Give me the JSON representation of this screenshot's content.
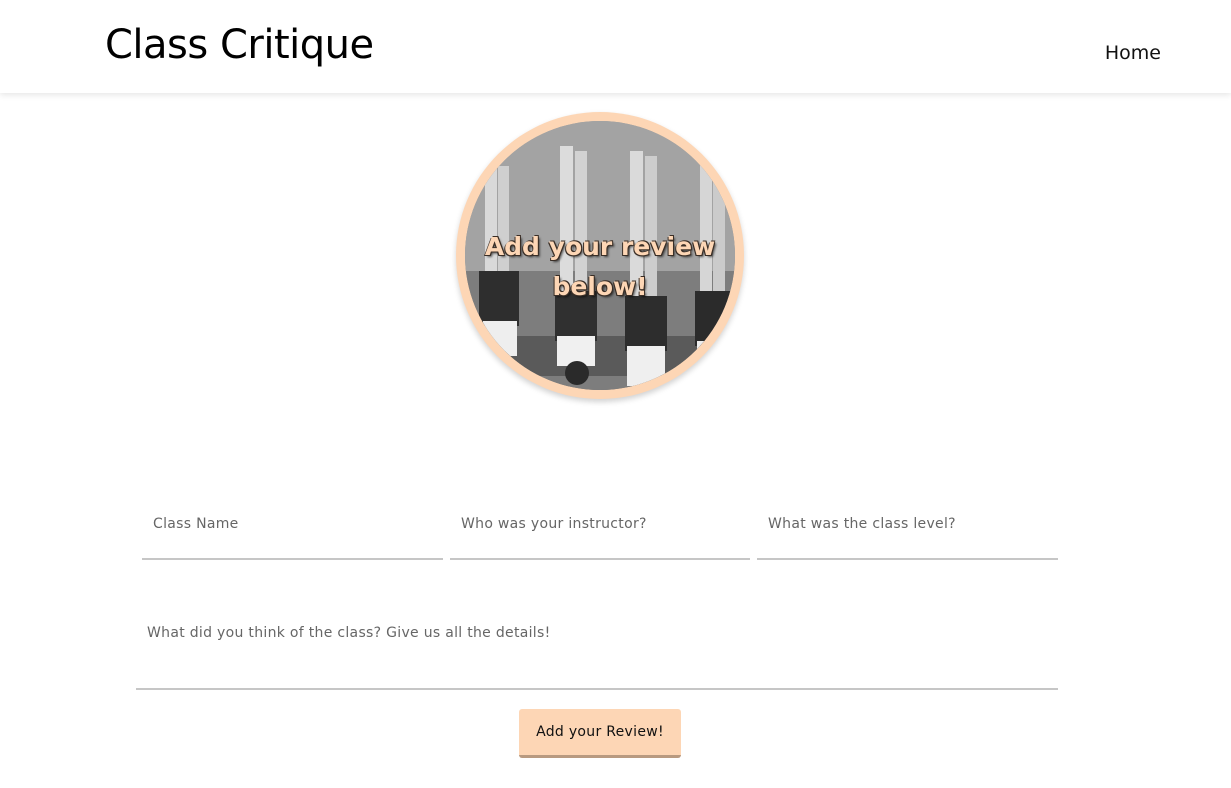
{
  "navbar": {
    "brand": "Class Critique",
    "links": [
      {
        "label": "Home"
      }
    ]
  },
  "hero": {
    "image_alt": "vintage black and white photo of women doing headstands",
    "text_line1": "Add your review",
    "text_line2": "below!",
    "accent_color": "#fdd6b5"
  },
  "form": {
    "class_name_placeholder": "Class Name",
    "instructor_placeholder": "Who was your instructor?",
    "level_placeholder": "What was the class level?",
    "details_placeholder": "What did you think of the class? Give us all the details!",
    "submit_label": "Add your Review!"
  }
}
